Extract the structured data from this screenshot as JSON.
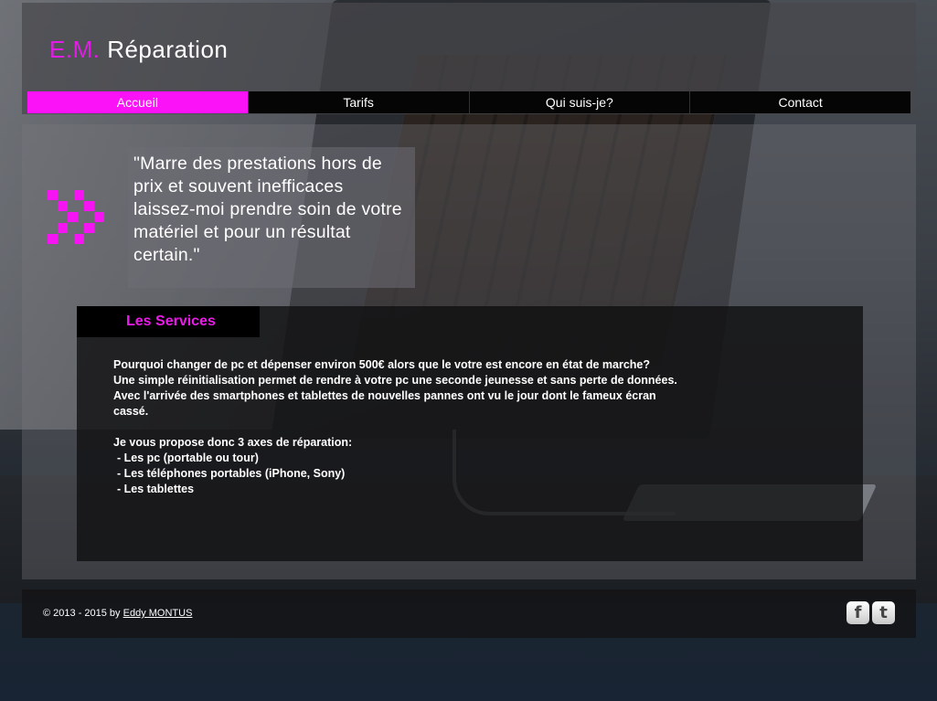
{
  "brand": {
    "prefix": "E.M.",
    "name": "Réparation",
    "accent_color": "#e21be6"
  },
  "nav": {
    "items": [
      {
        "label": "Accueil",
        "active": true
      },
      {
        "label": "Tarifs",
        "active": false
      },
      {
        "label": "Qui suis-je?",
        "active": false
      },
      {
        "label": "Contact",
        "active": false
      }
    ],
    "active_color": "#fb12f7"
  },
  "quote": {
    "text": "\"Marre des prestations hors de prix et souvent inefficaces laissez-moi prendre soin de votre matériel et pour un résultat certain.\"",
    "icon": "double-chevron-right-icon"
  },
  "services": {
    "title": "Les Services",
    "lines": [
      "Pourquoi changer de pc et dépenser environ 500€ alors que le votre est encore en état de marche?",
      "Une simple réinitialisation permet de rendre à votre pc une seconde jeunesse et sans perte de données.",
      "Avec l'arrivée des smartphones et tablettes de nouvelles pannes ont vu le jour dont le fameux écran cassé."
    ],
    "intro": "Je vous propose donc 3 axes de réparation:",
    "axes": [
      "- Les pc (portable ou tour)",
      "- Les téléphones portables (iPhone, Sony)",
      "- Les tablettes"
    ]
  },
  "footer": {
    "copyright": "© 2013 - 2015 by",
    "author": "Eddy MONTUS",
    "social": [
      {
        "name": "facebook-icon",
        "glyph": "f"
      },
      {
        "name": "twitter-icon",
        "glyph": "t"
      }
    ]
  }
}
